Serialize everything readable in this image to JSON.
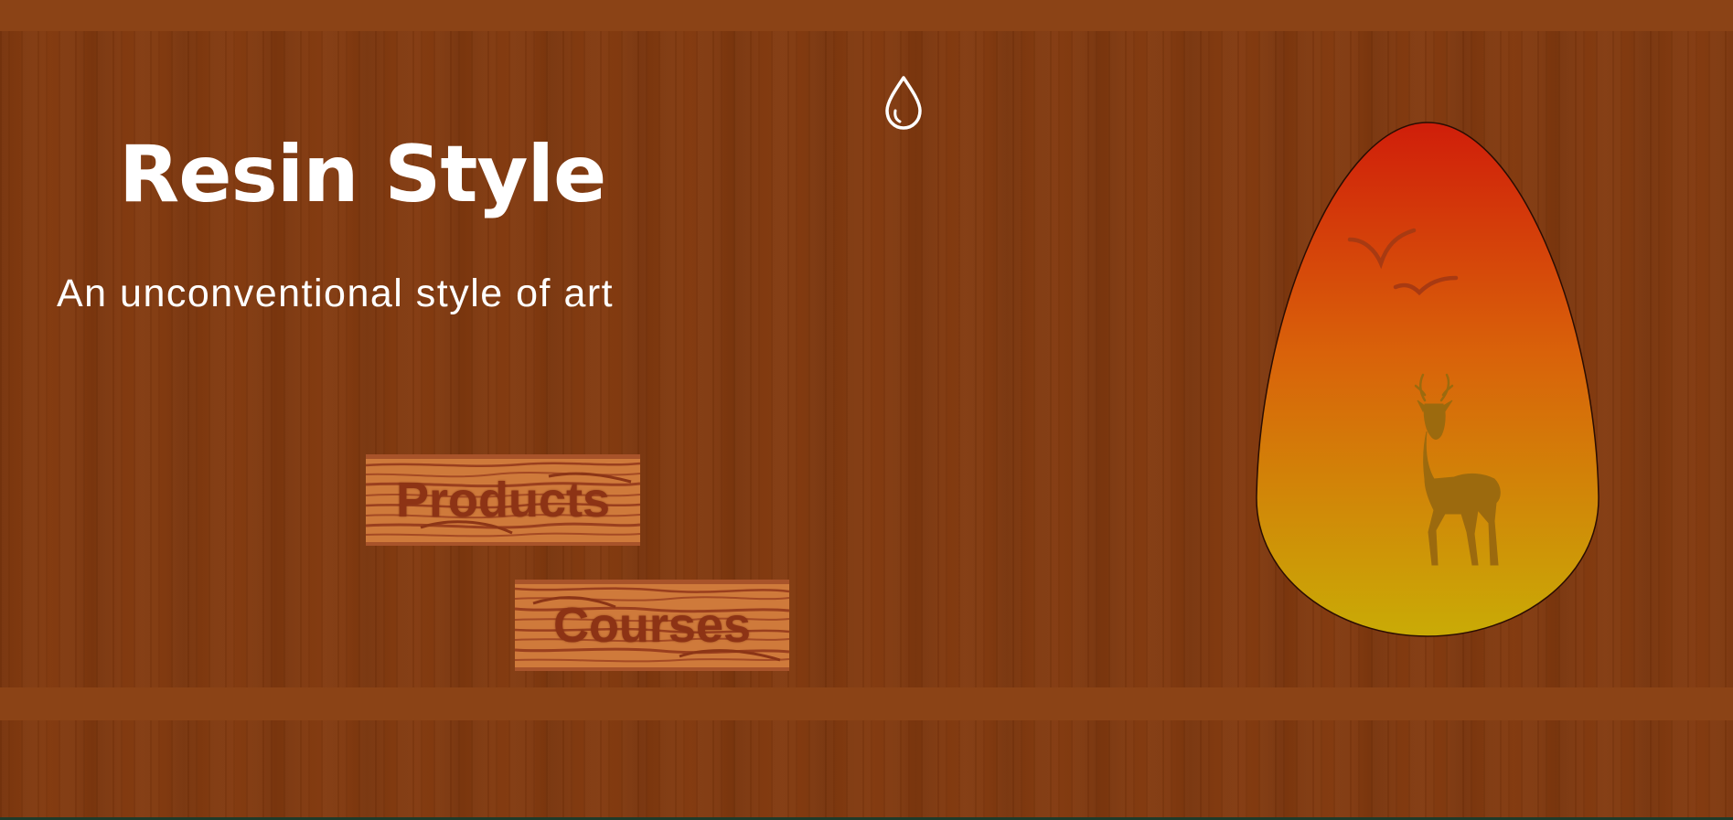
{
  "header": {
    "title": "Resin Style",
    "tagline": "An unconventional style of art"
  },
  "navigation": {
    "buttons": [
      {
        "label": "Products"
      },
      {
        "label": "Courses"
      }
    ]
  },
  "icons": {
    "logo": "resin-drop-icon",
    "illustration": "resin-egg-art",
    "birds": "birds-icon",
    "deer": "deer-icon"
  },
  "colors": {
    "wood_background": "#813a10",
    "shelf": "#8b4316",
    "text": "#ffffff",
    "plank_wood": "#cf7a3b",
    "plank_text": "#8d3315",
    "resin_top": "#d01e0a",
    "resin_middle": "#d9620a",
    "resin_bottom": "#c9ab06"
  }
}
